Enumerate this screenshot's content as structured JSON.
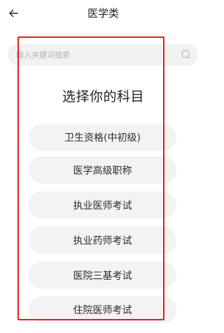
{
  "header": {
    "title": "医学类",
    "back_icon": "arrow-left-icon"
  },
  "search": {
    "placeholder": "输入关键词搜索",
    "icon": "search-icon"
  },
  "heading": "选择你的科目",
  "subjects": [
    {
      "label": "卫生资格(中初级)"
    },
    {
      "label": "医学高级职称"
    },
    {
      "label": "执业医师考试"
    },
    {
      "label": "执业药师考试"
    },
    {
      "label": "医院三基考试"
    },
    {
      "label": "住院医师考试"
    }
  ],
  "colors": {
    "highlight": "#e02020",
    "pill_bg": "#f3f3f3",
    "search_bg": "#f2f2f2"
  }
}
